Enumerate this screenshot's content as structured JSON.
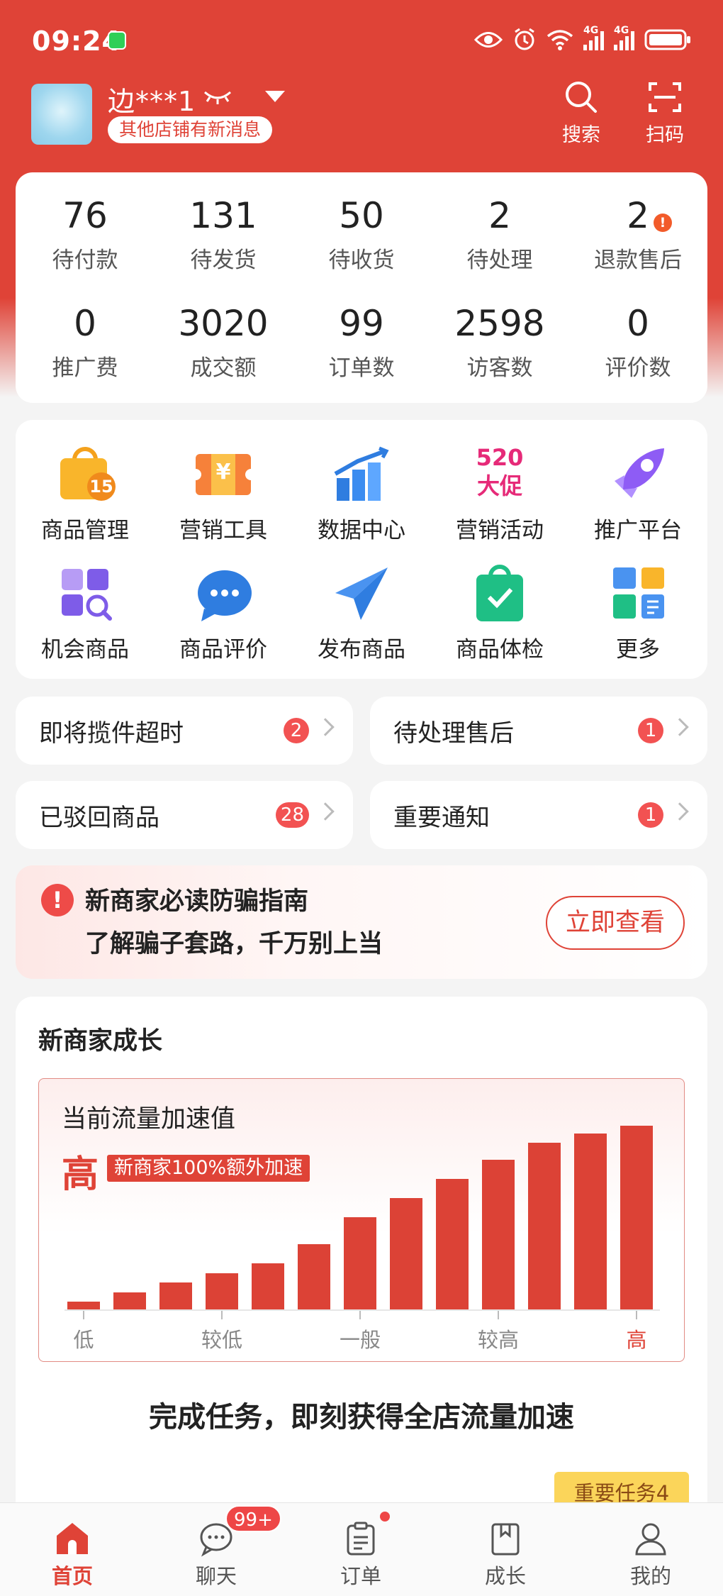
{
  "status_bar": {
    "time": "09:24",
    "network_1": "4G",
    "network_2": "4G"
  },
  "shop": {
    "name": "边***1",
    "notice": "其他店铺有新消息",
    "search_label": "搜索",
    "scan_label": "扫码"
  },
  "stats": [
    {
      "value": "76",
      "label": "待付款"
    },
    {
      "value": "131",
      "label": "待发货"
    },
    {
      "value": "50",
      "label": "待收货"
    },
    {
      "value": "2",
      "label": "待处理"
    },
    {
      "value": "2",
      "label": "退款售后",
      "alert": "!"
    },
    {
      "value": "0",
      "label": "推广费"
    },
    {
      "value": "3020",
      "label": "成交额"
    },
    {
      "value": "99",
      "label": "订单数"
    },
    {
      "value": "2598",
      "label": "访客数"
    },
    {
      "value": "0",
      "label": "评价数"
    }
  ],
  "tools": [
    {
      "label": "商品管理",
      "icon": "shopping-bag-icon",
      "icon_text": "15"
    },
    {
      "label": "营销工具",
      "icon": "coupon-icon",
      "icon_text": "¥"
    },
    {
      "label": "数据中心",
      "icon": "bar-chart-icon"
    },
    {
      "label": "营销活动",
      "icon": "promo-520-icon",
      "icon_text_1": "520",
      "icon_text_2": "大促"
    },
    {
      "label": "推广平台",
      "icon": "rocket-icon"
    },
    {
      "label": "机会商品",
      "icon": "grid-search-icon"
    },
    {
      "label": "商品评价",
      "icon": "chat-bubble-icon"
    },
    {
      "label": "发布商品",
      "icon": "paper-plane-icon"
    },
    {
      "label": "商品体检",
      "icon": "check-bag-icon"
    },
    {
      "label": "更多",
      "icon": "more-apps-icon"
    }
  ],
  "alerts": [
    {
      "label": "即将揽件超时",
      "count": "2"
    },
    {
      "label": "待处理售后",
      "count": "1"
    },
    {
      "label": "已驳回商品",
      "count": "28"
    },
    {
      "label": "重要通知",
      "count": "1"
    }
  ],
  "scam_banner": {
    "line1": "新商家必读防骗指南",
    "line2": "了解骗子套路，千万别上当",
    "button": "立即查看"
  },
  "growth": {
    "title": "新商家成长",
    "chart_title": "当前流量加速值",
    "level": "高",
    "tag": "新商家100%额外加速",
    "cta": "完成任务，即刻获得全店流量加速",
    "task_tag": "重要任务4"
  },
  "chart_data": {
    "type": "bar",
    "title": "当前流量加速值",
    "x_tick_labels": [
      "低",
      "较低",
      "一般",
      "较高",
      "高"
    ],
    "values": [
      4,
      9,
      14,
      19,
      24,
      34,
      48,
      58,
      68,
      78,
      87,
      92,
      96
    ],
    "ylim": [
      0,
      100
    ],
    "highlight_tick": "高",
    "color": "#dc4236"
  },
  "tabs": [
    {
      "label": "首页",
      "icon": "home-icon",
      "active": true
    },
    {
      "label": "聊天",
      "icon": "chat-icon",
      "badge": "99+"
    },
    {
      "label": "订单",
      "icon": "order-icon",
      "dot": true
    },
    {
      "label": "成长",
      "icon": "book-icon"
    },
    {
      "label": "我的",
      "icon": "user-icon"
    }
  ],
  "colors": {
    "brand_red": "#df4337",
    "badge_red": "#f25252",
    "bg": "#f4f4f4"
  }
}
